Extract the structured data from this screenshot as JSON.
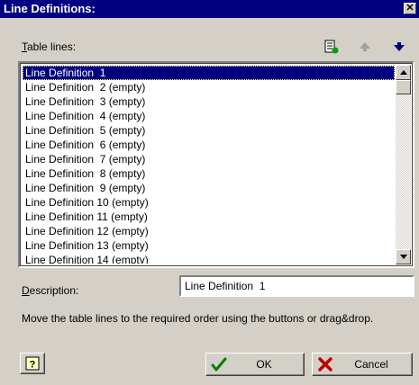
{
  "window": {
    "title": "Line Definitions:"
  },
  "table_lines": {
    "label_accel": "T",
    "label_rest": "able lines:",
    "items": [
      "Line Definition  1",
      "Line Definition  2 (empty)",
      "Line Definition  3 (empty)",
      "Line Definition  4 (empty)",
      "Line Definition  5 (empty)",
      "Line Definition  6 (empty)",
      "Line Definition  7 (empty)",
      "Line Definition  8 (empty)",
      "Line Definition  9 (empty)",
      "Line Definition 10 (empty)",
      "Line Definition 11 (empty)",
      "Line Definition 12 (empty)",
      "Line Definition 13 (empty)",
      "Line Definition 14 (empty)"
    ]
  },
  "description": {
    "label_accel": "D",
    "label_rest": "escription:",
    "value": "Line Definition  1"
  },
  "hint": "Move the table lines to the required order using the buttons or drag&drop.",
  "buttons": {
    "ok": "OK",
    "cancel": "Cancel"
  },
  "icons": {
    "add": "add-line-icon",
    "up": "move-up-icon",
    "down": "move-down-icon",
    "help": "help-icon",
    "ok": "checkmark-icon",
    "cancel": "red-x-icon"
  },
  "colors": {
    "titlebar": "#000080",
    "selection": "#000080",
    "ok_check": "#008000",
    "cancel_x": "#c00000",
    "down_arrow": "#000080"
  }
}
